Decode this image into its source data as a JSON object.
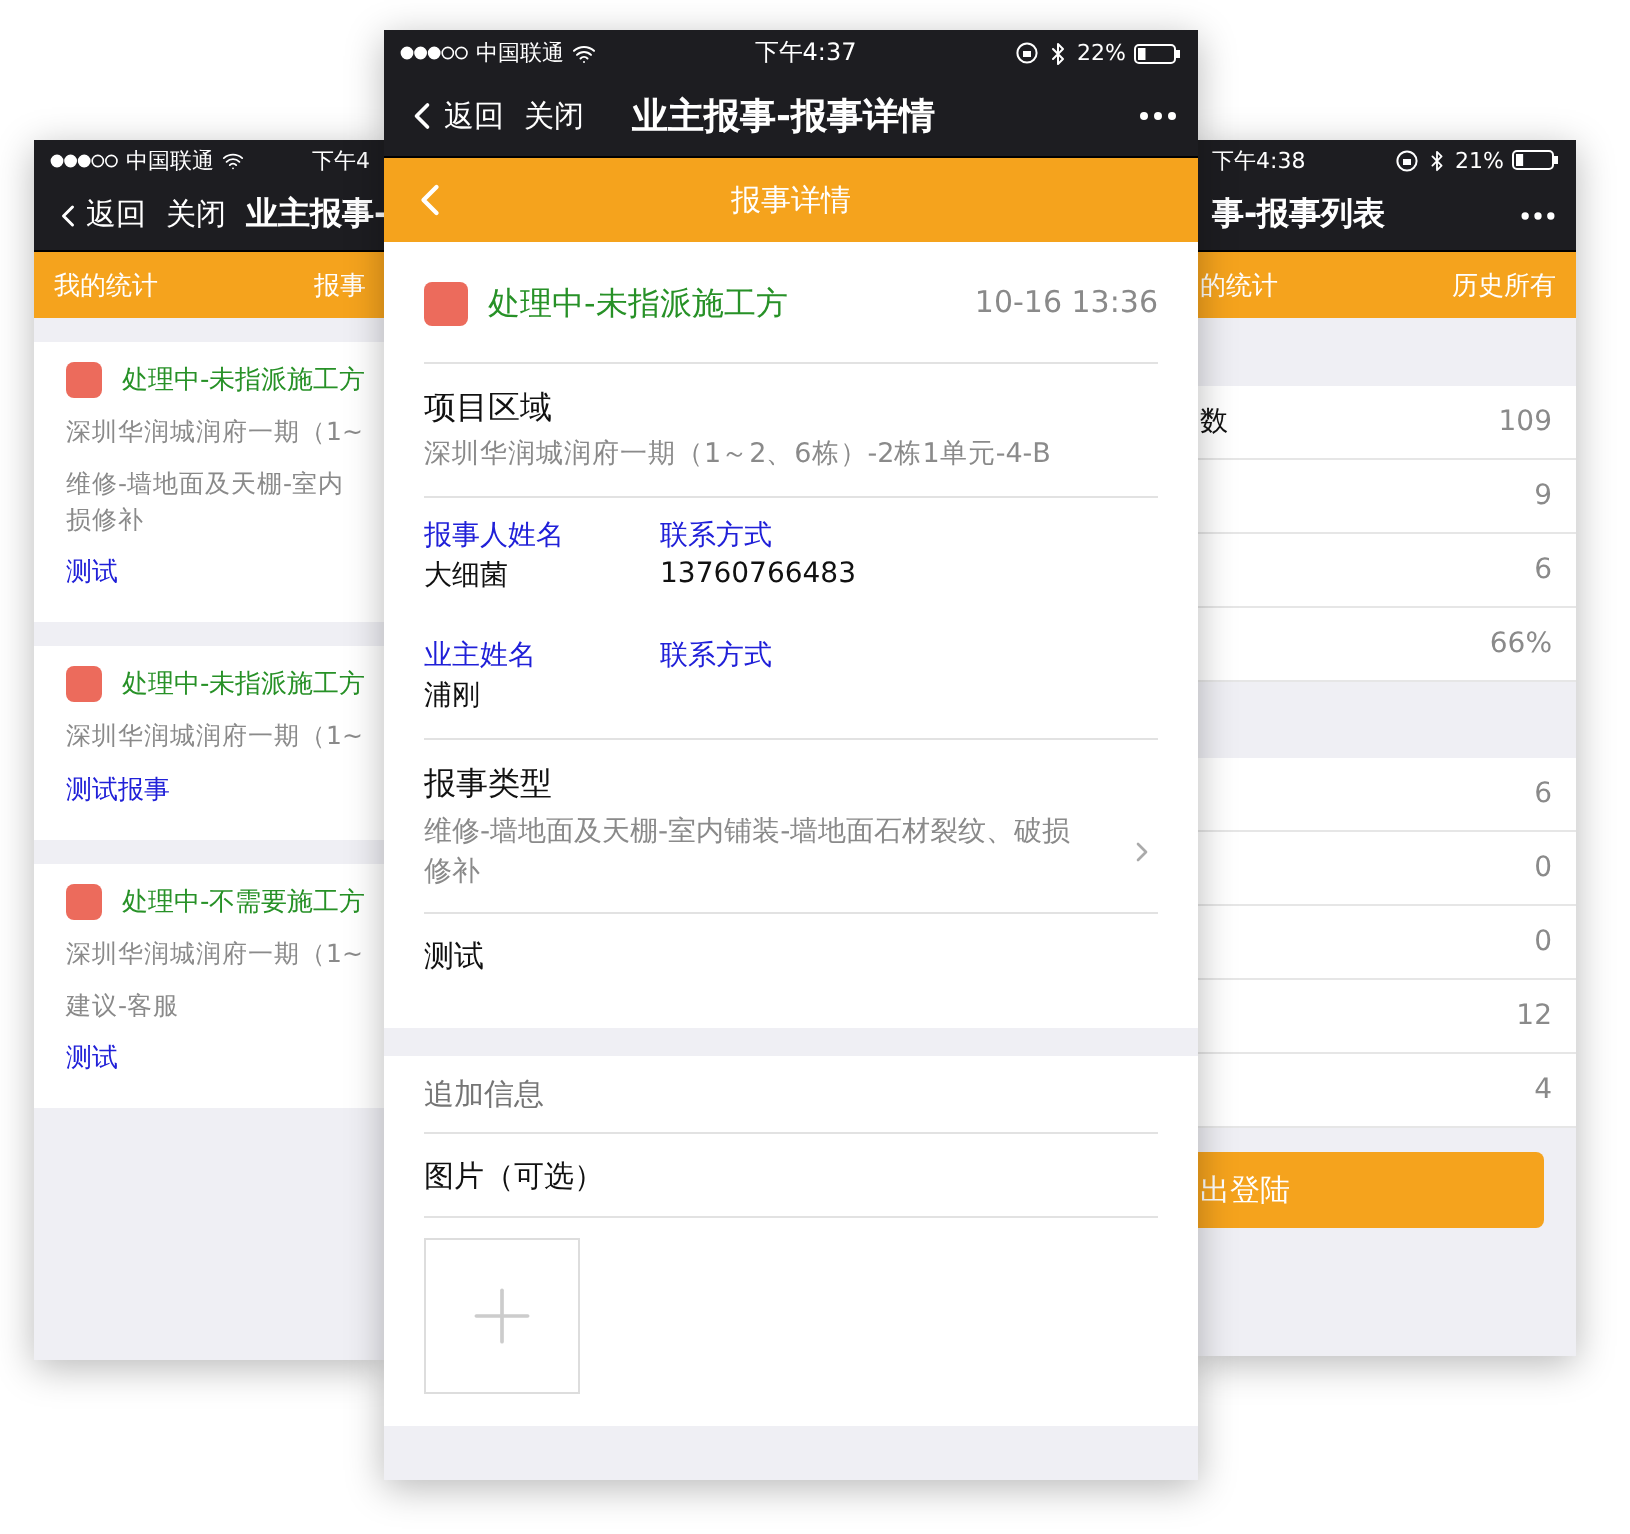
{
  "left_phone": {
    "status_bar": {
      "carrier": "中国联通",
      "time": "下午4"
    },
    "nav": {
      "back": "返回",
      "close": "关闭",
      "title": "业主报事-"
    },
    "tab_bar": [
      "我的统计",
      "报事"
    ],
    "cards": [
      {
        "status": "处理中-未指派施工方",
        "address": "深圳华润城润府一期（1~",
        "type_lines": [
          "维修-墙地面及天棚-室内",
          "损修补"
        ],
        "note": "测试"
      },
      {
        "status": "处理中-未指派施工方",
        "address": "深圳华润城润府一期（1~",
        "note": "测试报事"
      },
      {
        "status": "处理中-不需要施工方",
        "address": "深圳华润城润府一期（1~",
        "type_lines": [
          "建议-客服"
        ],
        "note": "测试"
      }
    ]
  },
  "center_phone": {
    "status_bar": {
      "carrier": "中国联通",
      "time": "下午4:37",
      "battery": "22%"
    },
    "nav": {
      "back": "返回",
      "close": "关闭",
      "title": "业主报事-报事详情"
    },
    "header": {
      "title": "报事详情"
    },
    "status": {
      "text": "处理中-未指派施工方",
      "time": "10-16 13:36"
    },
    "area": {
      "label": "项目区域",
      "value": "深圳华润城润府一期（1～2、6栋）-2栋1单元-4-B"
    },
    "contacts": [
      {
        "name_label": "报事人姓名",
        "name": "大细菌",
        "phone_label": "联系方式",
        "phone": "13760766483"
      },
      {
        "name_label": "业主姓名",
        "name": "浦刚",
        "phone_label": "联系方式"
      }
    ],
    "type": {
      "label": "报事类型",
      "value": "维修-墙地面及天棚-室内铺装-墙地面石材裂纹、破损修补"
    },
    "note": "测试",
    "extra": {
      "placeholder": "追加信息"
    },
    "photos": {
      "label": "图片（可选）"
    }
  },
  "right_phone": {
    "status_bar": {
      "time": "下午4:38",
      "battery": "21%"
    },
    "nav": {
      "title": "事-报事列表"
    },
    "tab_bar": [
      "的统计",
      "历史所有"
    ],
    "sections": [
      {
        "rows": [
          {
            "label": "数",
            "value": "109"
          },
          {
            "value": "9"
          },
          {
            "value": "6"
          },
          {
            "value": "66%"
          }
        ]
      },
      {
        "rows": [
          {
            "value": "6"
          },
          {
            "value": "0"
          },
          {
            "value": "0"
          },
          {
            "value": "12"
          },
          {
            "value": "4"
          }
        ]
      }
    ],
    "logout": "出登陆"
  }
}
